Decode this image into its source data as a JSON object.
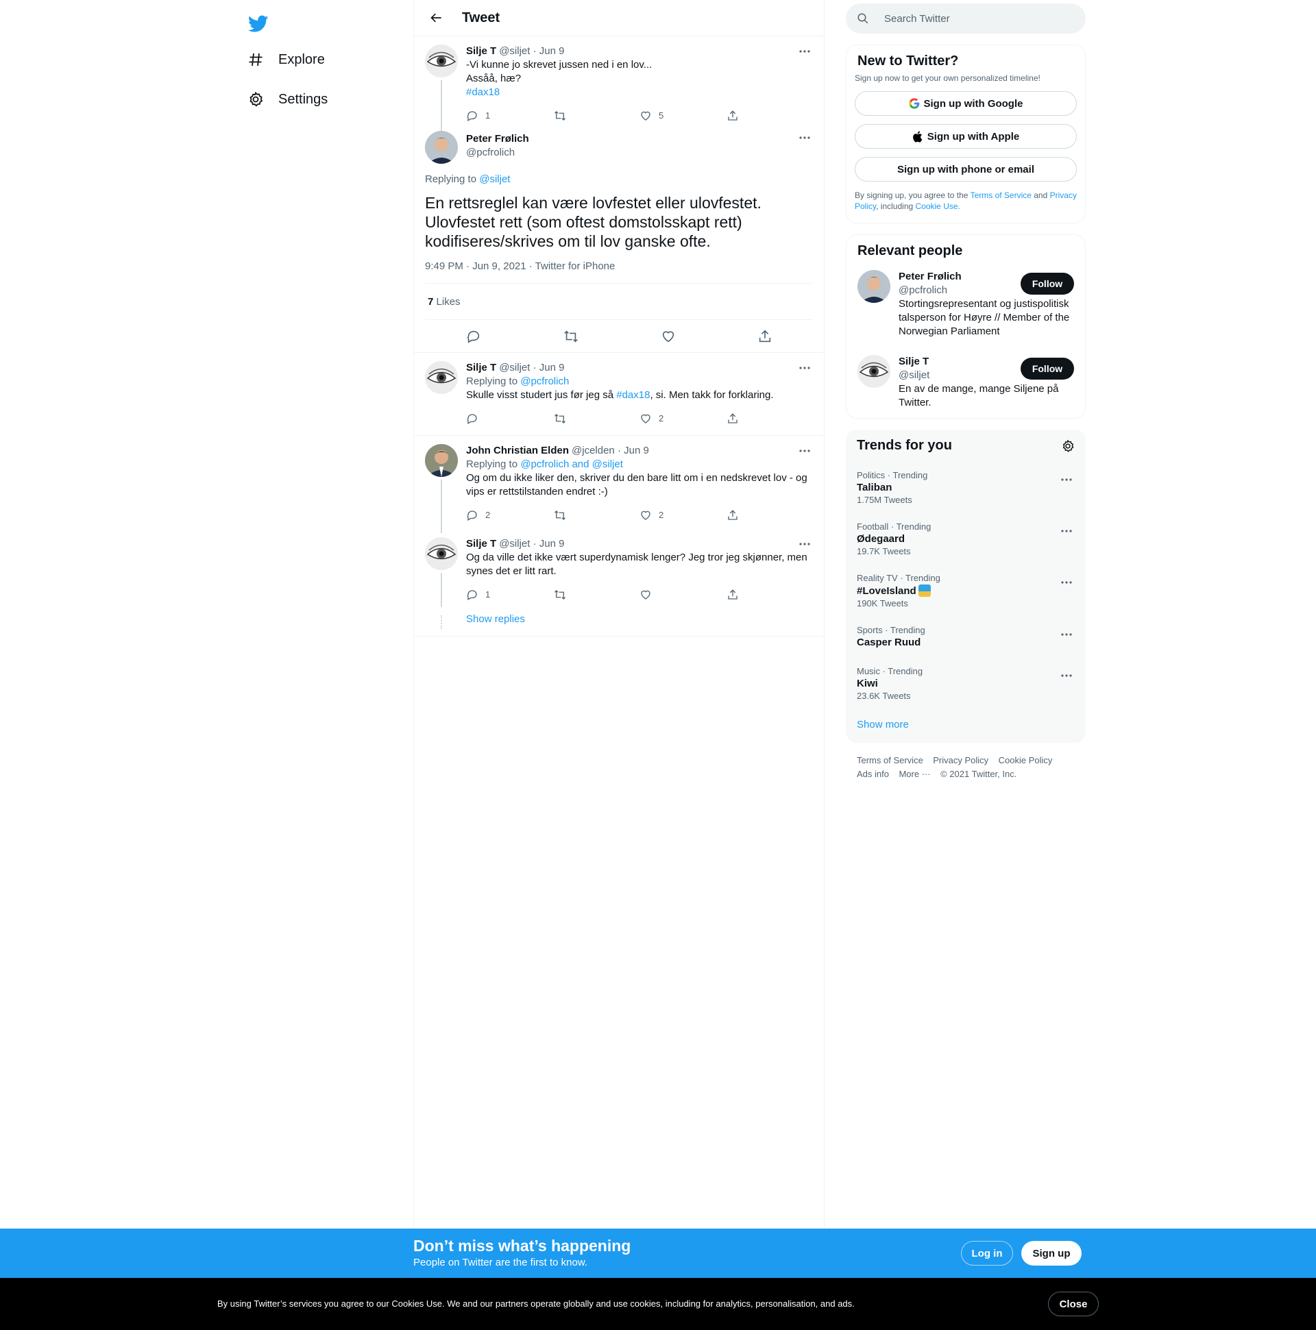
{
  "nav": {
    "explore": "Explore",
    "settings": "Settings"
  },
  "header": {
    "title": "Tweet"
  },
  "t1": {
    "name": "Silje T",
    "handle": "@siljet",
    "dot": "·",
    "date": "Jun 9",
    "line1": "-Vi kunne jo skrevet jussen ned i en lov...",
    "line2": "Assåå, hæ?",
    "tag": "#dax18",
    "replies": "1",
    "likes": "5"
  },
  "main": {
    "name": "Peter Frølich",
    "handle": "@pcfrolich",
    "replying": "Replying to",
    "replying_to": "@siljet",
    "text": "En rettsreglel kan være lovfestet eller ulovfestet. Ulovfestet rett (som oftest domstolsskapt rett) kodifiseres/skrives om til lov ganske ofte.",
    "time": "9:49 PM · Jun 9, 2021 · Twitter for iPhone",
    "likes_count": "7",
    "likes_label": "Likes"
  },
  "r1": {
    "name": "Silje T",
    "handle": "@siljet",
    "date": "Jun 9",
    "replying": "Replying to",
    "replying_to": "@pcfrolich",
    "text_a": "Skulle visst studert jus før jeg så ",
    "tag": "#dax18",
    "text_b": ", si. Men takk for forklaring.",
    "likes": "2"
  },
  "r2": {
    "name": "John Christian Elden",
    "handle": "@jcelden",
    "date": "Jun 9",
    "replying": "Replying to",
    "replying_to": "@pcfrolich and @siljet",
    "text": "Og om du ikke liker den, skriver du den bare litt om i en nedskrevet lov - og vips er rettstilstanden endret :-)",
    "replies": "2",
    "likes": "2"
  },
  "r3": {
    "name": "Silje T",
    "handle": "@siljet",
    "date": "Jun 9",
    "text": "Og da ville det ikke vært superdynamisk lenger? Jeg tror jeg skjønner, men synes det er litt rart.",
    "replies": "1",
    "show_replies": "Show replies"
  },
  "search": {
    "placeholder": "Search Twitter"
  },
  "signup": {
    "title": "New to Twitter?",
    "sub": "Sign up now to get your own personalized timeline!",
    "google": "Sign up with Google",
    "apple": "Sign up with Apple",
    "phone": "Sign up with phone or email",
    "legal_a": "By signing up, you agree to the ",
    "tos": "Terms of Service",
    "legal_b": " and",
    "pp": "Privacy Policy",
    "legal_c": ", including ",
    "cookie": "Cookie Use."
  },
  "people": {
    "title": "Relevant people",
    "p1": {
      "name": "Peter Frølich",
      "handle": "@pcfrolich",
      "bio": "Stortingsrepresentant og justispolitisk talsperson for Høyre // Member of the Norwegian Parliament",
      "follow": "Follow"
    },
    "p2": {
      "name": "Silje T",
      "handle": "@siljet",
      "bio": "En av de mange, mange Siljene på Twitter.",
      "follow": "Follow"
    }
  },
  "trends": {
    "title": "Trends for you",
    "items": [
      {
        "cat": "Politics · Trending",
        "name": "Taliban",
        "count": "1.75M Tweets"
      },
      {
        "cat": "Football · Trending",
        "name": "Ødegaard",
        "count": "19.7K Tweets"
      },
      {
        "cat": "Reality TV · Trending",
        "name": "#LoveIsland",
        "count": "190K Tweets"
      },
      {
        "cat": "Sports · Trending",
        "name": "Casper Ruud",
        "count": ""
      },
      {
        "cat": "Music · Trending",
        "name": "Kiwi",
        "count": "23.6K Tweets"
      }
    ],
    "show_more": "Show more"
  },
  "footer": {
    "tos": "Terms of Service",
    "pp": "Privacy Policy",
    "cp": "Cookie Policy",
    "ads": "Ads info",
    "more": "More ···",
    "copy": "© 2021 Twitter, Inc."
  },
  "banner": {
    "title": "Don’t miss what’s happening",
    "sub": "People on Twitter are the first to know.",
    "login": "Log in",
    "signup": "Sign up"
  },
  "cookie": {
    "text": "By using Twitter’s services you agree to our Cookies Use. We and our partners operate globally and use cookies, including for analytics, personalisation, and ads.",
    "close": "Close"
  },
  "colors": {
    "accent": "#1d9bf0",
    "text": "#0f1419",
    "muted": "#536471"
  }
}
